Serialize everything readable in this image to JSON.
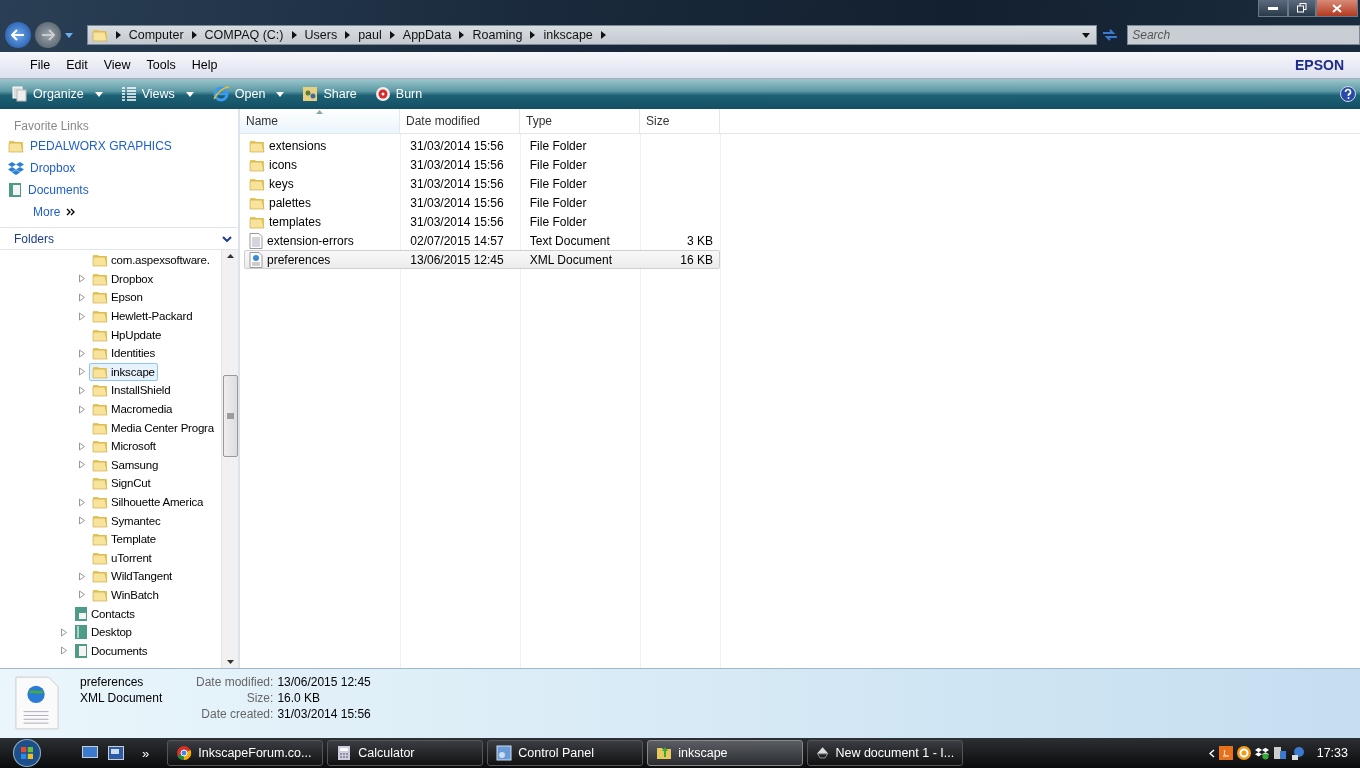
{
  "address": {
    "crumbs": [
      "Computer",
      "COMPAQ (C:)",
      "Users",
      "paul",
      "AppData",
      "Roaming",
      "inkscape"
    ]
  },
  "search": {
    "placeholder": "Search"
  },
  "menu": [
    "File",
    "Edit",
    "View",
    "Tools",
    "Help"
  ],
  "brand": "EPSON",
  "toolbar": [
    {
      "label": "Organize",
      "kind": "organize",
      "dropdown": true
    },
    {
      "label": "Views",
      "kind": "views",
      "dropdown": true
    },
    {
      "label": "Open",
      "kind": "browser",
      "dropdown": true
    },
    {
      "label": "Share",
      "kind": "share",
      "dropdown": false
    },
    {
      "label": "Burn",
      "kind": "burn",
      "dropdown": false
    }
  ],
  "favorites": {
    "title": "Favorite Links",
    "items": [
      {
        "label": "PEDALWORX GRAPHICS",
        "kind": "folder"
      },
      {
        "label": "Dropbox",
        "kind": "dropbox"
      },
      {
        "label": "Documents",
        "kind": "documents"
      }
    ],
    "more": "More"
  },
  "folders": {
    "title": "Folders",
    "tree": [
      {
        "children": [
          {
            "label": "com.aspexsoftware.",
            "expandable": false,
            "selected": false
          },
          {
            "label": "Dropbox",
            "expandable": true,
            "selected": false
          },
          {
            "label": "Epson",
            "expandable": true,
            "selected": false
          },
          {
            "label": "Hewlett-Packard",
            "expandable": true,
            "selected": false
          },
          {
            "label": "HpUpdate",
            "expandable": false,
            "selected": false
          },
          {
            "label": "Identities",
            "expandable": true,
            "selected": false
          },
          {
            "label": "inkscape",
            "expandable": true,
            "selected": true
          },
          {
            "label": "InstallShield",
            "expandable": true,
            "selected": false
          },
          {
            "label": "Macromedia",
            "expandable": true,
            "selected": false
          },
          {
            "label": "Media Center Progra",
            "expandable": false,
            "selected": false
          },
          {
            "label": "Microsoft",
            "expandable": true,
            "selected": false
          },
          {
            "label": "Samsung",
            "expandable": true,
            "selected": false
          },
          {
            "label": "SignCut",
            "expandable": false,
            "selected": false
          },
          {
            "label": "Silhouette America",
            "expandable": true,
            "selected": false
          },
          {
            "label": "Symantec",
            "expandable": true,
            "selected": false
          },
          {
            "label": "Template",
            "expandable": false,
            "selected": false
          },
          {
            "label": "uTorrent",
            "expandable": false,
            "selected": false
          },
          {
            "label": "WildTangent",
            "expandable": true,
            "selected": false
          },
          {
            "label": "WinBatch",
            "expandable": true,
            "selected": false
          }
        ]
      },
      {
        "label": "Contacts",
        "kind": "contacts",
        "expandable": false,
        "selected": false
      },
      {
        "label": "Desktop",
        "kind": "desktop",
        "expandable": true,
        "selected": false
      },
      {
        "label": "Documents",
        "kind": "documents",
        "expandable": true,
        "selected": false
      }
    ]
  },
  "columns": [
    {
      "label": "Name",
      "sorted": true
    },
    {
      "label": "Date modified",
      "sorted": false
    },
    {
      "label": "Type",
      "sorted": false
    },
    {
      "label": "Size",
      "sorted": false
    }
  ],
  "files": [
    {
      "name": "extensions",
      "kind": "folder",
      "date": "31/03/2014 15:56",
      "type": "File Folder",
      "selected": false
    },
    {
      "name": "icons",
      "kind": "folder",
      "date": "31/03/2014 15:56",
      "type": "File Folder",
      "selected": false
    },
    {
      "name": "keys",
      "kind": "folder",
      "date": "31/03/2014 15:56",
      "type": "File Folder",
      "selected": false
    },
    {
      "name": "palettes",
      "kind": "folder",
      "date": "31/03/2014 15:56",
      "type": "File Folder",
      "selected": false
    },
    {
      "name": "templates",
      "kind": "folder",
      "date": "31/03/2014 15:56",
      "type": "File Folder",
      "selected": false
    },
    {
      "name": "extension-errors",
      "kind": "text",
      "date": "02/07/2015 14:57",
      "type": "Text Document",
      "size": "3 KB",
      "selected": false
    },
    {
      "name": "preferences",
      "kind": "xml",
      "date": "13/06/2015 12:45",
      "type": "XML Document",
      "size": "16 KB",
      "selected": true
    }
  ],
  "details": {
    "name": "preferences",
    "type": "XML Document",
    "fields": [
      {
        "label": "Date modified:",
        "value": "13/06/2015 12:45"
      },
      {
        "label": "Size:",
        "value": "16.0 KB"
      },
      {
        "label": "Date created:",
        "value": "31/03/2014 15:56"
      }
    ]
  },
  "taskbar": {
    "more": "»",
    "buttons": [
      {
        "label": "InkscapeForum.co...",
        "kind": "chrome",
        "selected": false
      },
      {
        "label": "Calculator",
        "kind": "calculator",
        "selected": false
      },
      {
        "label": "Control Panel",
        "kind": "control",
        "selected": false
      },
      {
        "label": "inkscape",
        "kind": "folder",
        "selected": true
      },
      {
        "label": "New document 1 - I...",
        "kind": "inkscape",
        "selected": false
      }
    ],
    "clock": "17:33"
  }
}
